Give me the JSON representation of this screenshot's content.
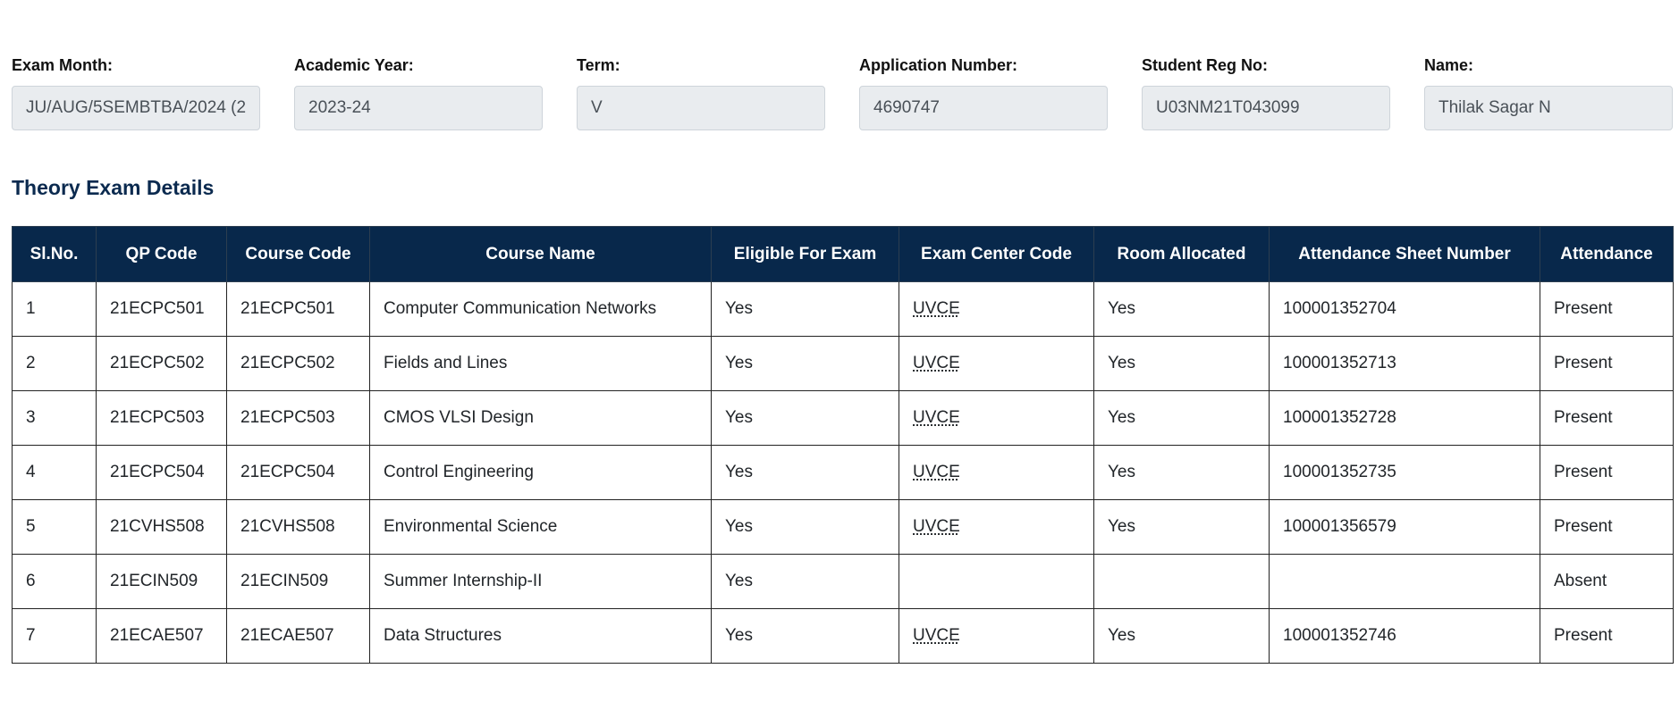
{
  "fields": [
    {
      "key": "exam-month",
      "label": "Exam Month:",
      "value": "JU/AUG/5SEMBTBA/2024 (2"
    },
    {
      "key": "academic-year",
      "label": "Academic Year:",
      "value": "2023-24"
    },
    {
      "key": "term",
      "label": "Term:",
      "value": "V"
    },
    {
      "key": "application-number",
      "label": "Application Number:",
      "value": "4690747"
    },
    {
      "key": "student-reg-no",
      "label": "Student Reg No:",
      "value": "U03NM21T043099"
    },
    {
      "key": "name",
      "label": "Name:",
      "value": "Thilak Sagar N"
    }
  ],
  "section_title": "Theory Exam Details",
  "table": {
    "columns": [
      "Sl.No.",
      "QP Code",
      "Course Code",
      "Course Name",
      "Eligible For Exam",
      "Exam Center Code",
      "Room Allocated",
      "Attendance Sheet Number",
      "Attendance"
    ],
    "rows": [
      [
        "1",
        "21ECPC501",
        "21ECPC501",
        "Computer Communication Networks",
        "Yes",
        "UVCE",
        "Yes",
        "100001352704",
        "Present"
      ],
      [
        "2",
        "21ECPC502",
        "21ECPC502",
        "Fields and Lines",
        "Yes",
        "UVCE",
        "Yes",
        "100001352713",
        "Present"
      ],
      [
        "3",
        "21ECPC503",
        "21ECPC503",
        "CMOS VLSI Design",
        "Yes",
        "UVCE",
        "Yes",
        "100001352728",
        "Present"
      ],
      [
        "4",
        "21ECPC504",
        "21ECPC504",
        "Control Engineering",
        "Yes",
        "UVCE",
        "Yes",
        "100001352735",
        "Present"
      ],
      [
        "5",
        "21CVHS508",
        "21CVHS508",
        "Environmental Science",
        "Yes",
        "UVCE",
        "Yes",
        "100001356579",
        "Present"
      ],
      [
        "6",
        "21ECIN509",
        "21ECIN509",
        "Summer Internship-II",
        "Yes",
        "",
        "",
        "",
        "Absent"
      ],
      [
        "7",
        "21ECAE507",
        "21ECAE507",
        "Data Structures",
        "Yes",
        "UVCE",
        "Yes",
        "100001352746",
        "Present"
      ]
    ]
  }
}
